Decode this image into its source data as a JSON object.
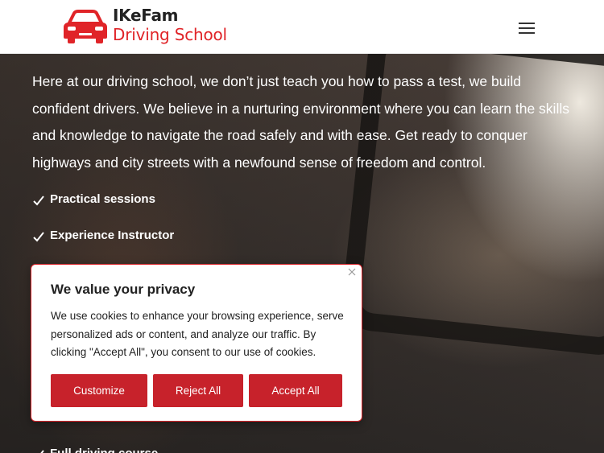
{
  "header": {
    "logo_line1": "IKeFam",
    "logo_line2": "Driving School",
    "brand_color": "#e02428",
    "menu_icon": "hamburger-menu-icon"
  },
  "hero": {
    "paragraph": "Here at our driving school, we don’t just teach you how to pass a test, we build confident drivers. We believe in a nurturing environment where you can learn the skills and knowledge to navigate the road safely and with ease. Get ready to conquer highways and city streets with a newfound sense of freedom and control.",
    "checklist": [
      {
        "label": "Practical sessions"
      },
      {
        "label": "Experience Instructor"
      }
    ],
    "partial_item": "Full driving course"
  },
  "cookie": {
    "title": "We value your privacy",
    "body": "We use cookies to enhance your browsing experience, serve personalized ads or content, and analyze our traffic. By clicking \"Accept All\", you consent to our use of cookies.",
    "customize_label": "Customize",
    "reject_label": "Reject All",
    "accept_label": "Accept All",
    "accent_color": "#c7222b",
    "close_icon": "close-icon"
  }
}
